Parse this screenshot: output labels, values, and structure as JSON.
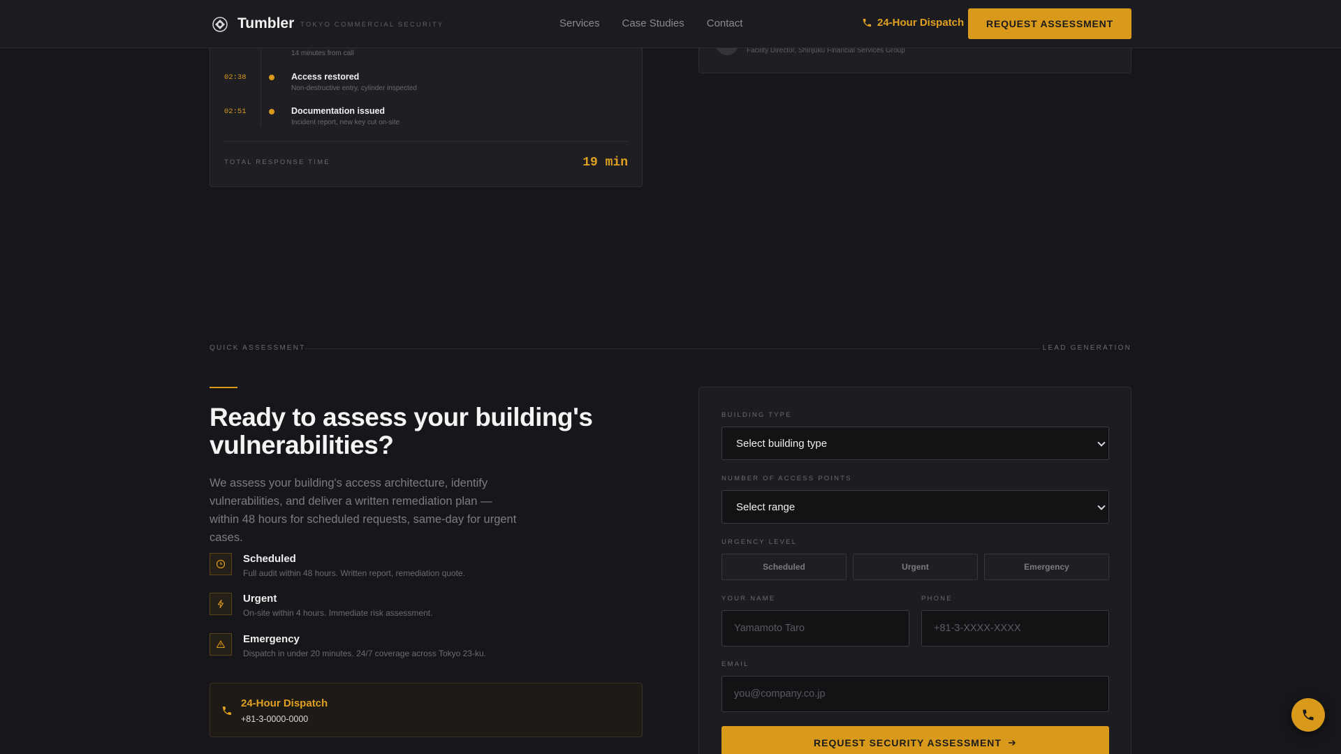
{
  "nav": {
    "brand": "Tumbler",
    "tagline": "TOKYO COMMERCIAL SECURITY",
    "links": [
      "Services",
      "Case Studies",
      "Contact"
    ],
    "dispatch_label": "24-Hour Dispatch",
    "cta_label": "REQUEST ASSESSMENT"
  },
  "timeline": {
    "fragment_text": "14 minutes from call",
    "events": [
      {
        "time": "02:38",
        "title": "Access restored",
        "desc": "Non-destructive entry, cylinder inspected"
      },
      {
        "time": "02:51",
        "title": "Documentation issued",
        "desc": "Incident report, new key cut on-site"
      }
    ],
    "total_label": "TOTAL RESPONSE TIME",
    "total_value": "19 min"
  },
  "testimonial": {
    "role": "Facility Director, Shinjuku Financial Services Group"
  },
  "section": {
    "left_label": "QUICK ASSESSMENT",
    "right_label": "LEAD GENERATION"
  },
  "pitch": {
    "headline": "Ready to assess your building's vulnerabilities?",
    "lead": "We assess your building's access architecture, identify vulnerabilities, and deliver a written remediation plan — within 48 hours for scheduled requests, same-day for urgent cases.",
    "tiers": [
      {
        "icon": "clock-icon",
        "name": "Scheduled",
        "desc": "Full audit within 48 hours. Written report, remediation quote."
      },
      {
        "icon": "lightning-icon",
        "name": "Urgent",
        "desc": "On-site within 4 hours. Immediate risk assessment."
      },
      {
        "icon": "warning-icon",
        "name": "Emergency",
        "desc": "Dispatch in under 20 minutes. 24/7 coverage across Tokyo 23-ku."
      }
    ],
    "dispatch_title": "24-Hour Dispatch",
    "dispatch_phone": "+81-3-0000-0000"
  },
  "form": {
    "building_type_label": "BUILDING TYPE",
    "building_type_value": "Select building type",
    "access_points_label": "NUMBER OF ACCESS POINTS",
    "access_points_value": "Select range",
    "urgency_label": "URGENCY LEVEL",
    "urgency_options": [
      "Scheduled",
      "Urgent",
      "Emergency"
    ],
    "name_label": "YOUR NAME",
    "name_placeholder": "Yamamoto Taro",
    "phone_label": "PHONE",
    "phone_placeholder": "+81-3-XXXX-XXXX",
    "email_label": "EMAIL",
    "email_placeholder": "you@company.co.jp",
    "submit_label": "REQUEST SECURITY ASSESSMENT"
  },
  "colors": {
    "accent": "#d99a1c",
    "background": "#17171b",
    "card": "#1e1e23"
  }
}
